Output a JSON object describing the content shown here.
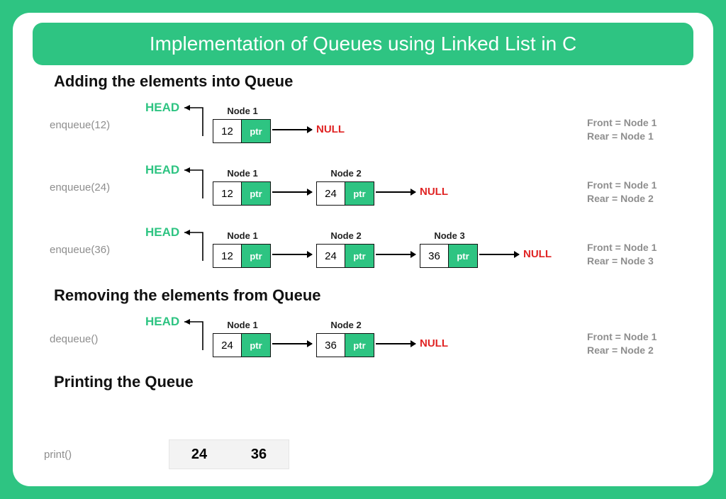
{
  "title": "Implementation of Queues using Linked List in C",
  "colors": {
    "accent": "#2ec482",
    "null": "#e02424",
    "muted": "#8e8e8e"
  },
  "sections": {
    "add": "Adding the elements into Queue",
    "remove": "Removing the elements from Queue",
    "print": "Printing the Queue"
  },
  "labels": {
    "head": "HEAD",
    "ptr": "ptr",
    "null": "NULL",
    "node_prefix": "Node"
  },
  "rows": [
    {
      "op": "enqueue(12)",
      "nodes": [
        {
          "label": "Node 1",
          "value": "12"
        }
      ],
      "status": {
        "front": "Front = Node 1",
        "rear": "Rear = Node 1"
      }
    },
    {
      "op": "enqueue(24)",
      "nodes": [
        {
          "label": "Node 1",
          "value": "12"
        },
        {
          "label": "Node 2",
          "value": "24"
        }
      ],
      "status": {
        "front": "Front = Node 1",
        "rear": "Rear = Node 2"
      }
    },
    {
      "op": "enqueue(36)",
      "nodes": [
        {
          "label": "Node 1",
          "value": "12"
        },
        {
          "label": "Node 2",
          "value": "24"
        },
        {
          "label": "Node 3",
          "value": "36"
        }
      ],
      "status": {
        "front": "Front = Node 1",
        "rear": "Rear = Node 3"
      }
    },
    {
      "op": "dequeue()",
      "nodes": [
        {
          "label": "Node 1",
          "value": "24"
        },
        {
          "label": "Node 2",
          "value": "36"
        }
      ],
      "status": {
        "front": "Front = Node 1",
        "rear": "Rear = Node 2"
      }
    }
  ],
  "print": {
    "op": "print()",
    "values": [
      "24",
      "36"
    ]
  }
}
